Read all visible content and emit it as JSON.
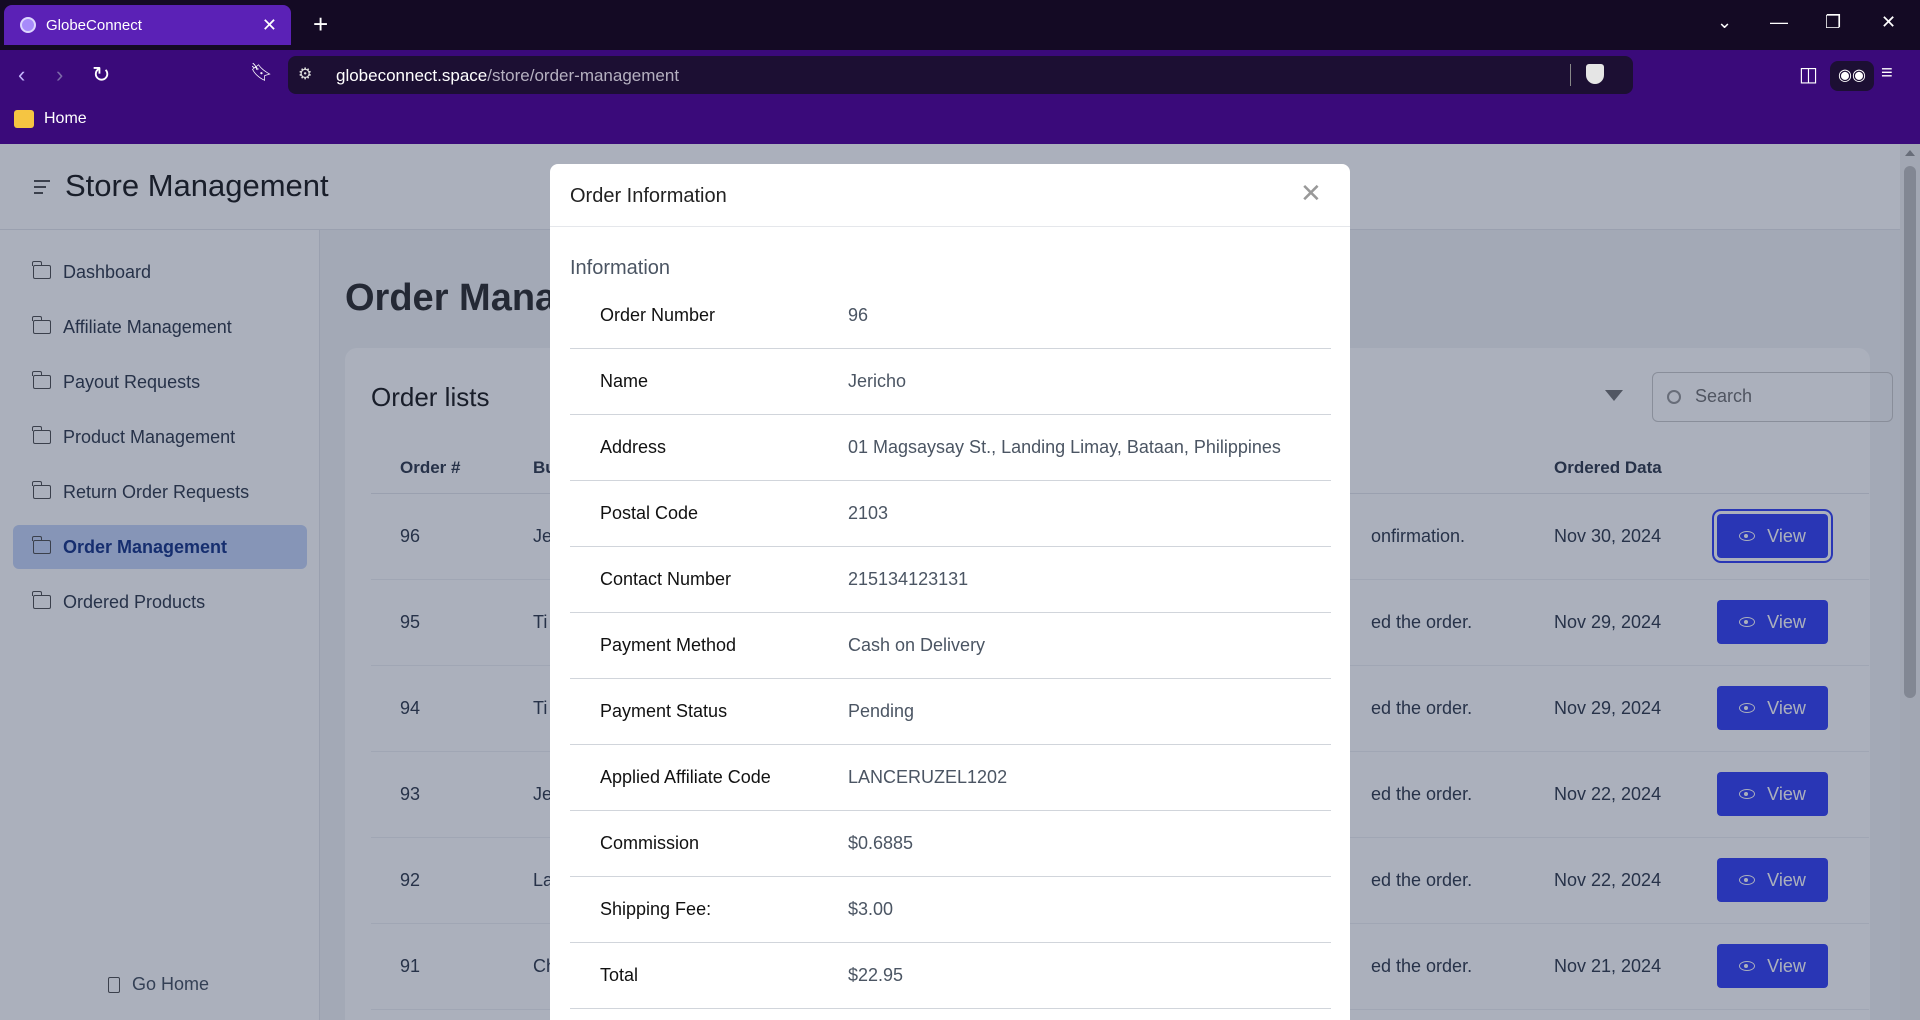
{
  "browser": {
    "tab_title": "GlobeConnect",
    "url_domain": "globeconnect.space",
    "url_path": "/store/order-management",
    "bookmark_home": "Home"
  },
  "app": {
    "title": "Store Management",
    "go_home": "Go Home"
  },
  "sidebar": {
    "items": [
      {
        "label": "Dashboard",
        "active": false
      },
      {
        "label": "Affiliate Management",
        "active": false
      },
      {
        "label": "Payout Requests",
        "active": false
      },
      {
        "label": "Product Management",
        "active": false
      },
      {
        "label": "Return Order Requests",
        "active": false
      },
      {
        "label": "Order Management",
        "active": true
      },
      {
        "label": "Ordered Products",
        "active": false
      }
    ]
  },
  "main": {
    "heading": "Order Management",
    "card_title": "Order lists",
    "search_placeholder": "Search",
    "columns": {
      "order_num": "Order #",
      "buyer": "Bu",
      "ordered_date": "Ordered Data"
    },
    "view_label": "View",
    "rows": [
      {
        "num": "96",
        "buyer": "Je",
        "status": "onfirmation.",
        "date": "Nov 30, 2024"
      },
      {
        "num": "95",
        "buyer": "Ti",
        "status": "ed the order.",
        "date": "Nov 29, 2024"
      },
      {
        "num": "94",
        "buyer": "Ti",
        "status": "ed the order.",
        "date": "Nov 29, 2024"
      },
      {
        "num": "93",
        "buyer": "Je",
        "status": "ed the order.",
        "date": "Nov 22, 2024"
      },
      {
        "num": "92",
        "buyer": "La",
        "status": "ed the order.",
        "date": "Nov 22, 2024"
      },
      {
        "num": "91",
        "buyer": "Ch",
        "status": "ed the order.",
        "date": "Nov 21, 2024"
      }
    ]
  },
  "modal": {
    "title": "Order Information",
    "section_title": "Information",
    "fields": [
      {
        "label": "Order Number",
        "value": "96"
      },
      {
        "label": "Name",
        "value": "Jericho"
      },
      {
        "label": "Address",
        "value": "01 Magsaysay St., Landing Limay, Bataan, Philippines"
      },
      {
        "label": "Postal Code",
        "value": "2103"
      },
      {
        "label": "Contact Number",
        "value": "215134123131"
      },
      {
        "label": "Payment Method",
        "value": "Cash on Delivery"
      },
      {
        "label": "Payment Status",
        "value": "Pending"
      },
      {
        "label": "Applied Affiliate Code",
        "value": "LANCERUZEL1202"
      },
      {
        "label": "Commission",
        "value": "$0.6885"
      },
      {
        "label": "Shipping Fee:",
        "value": "$3.00"
      },
      {
        "label": "Total",
        "value": "$22.95"
      }
    ]
  },
  "colors": {
    "browser_tabbar": "#140a24",
    "browser_toolbar": "#3a0a7a",
    "active_tab": "#5b21b6",
    "view_button": "#3b47f5",
    "sidebar_active": "#c7d7f8"
  }
}
